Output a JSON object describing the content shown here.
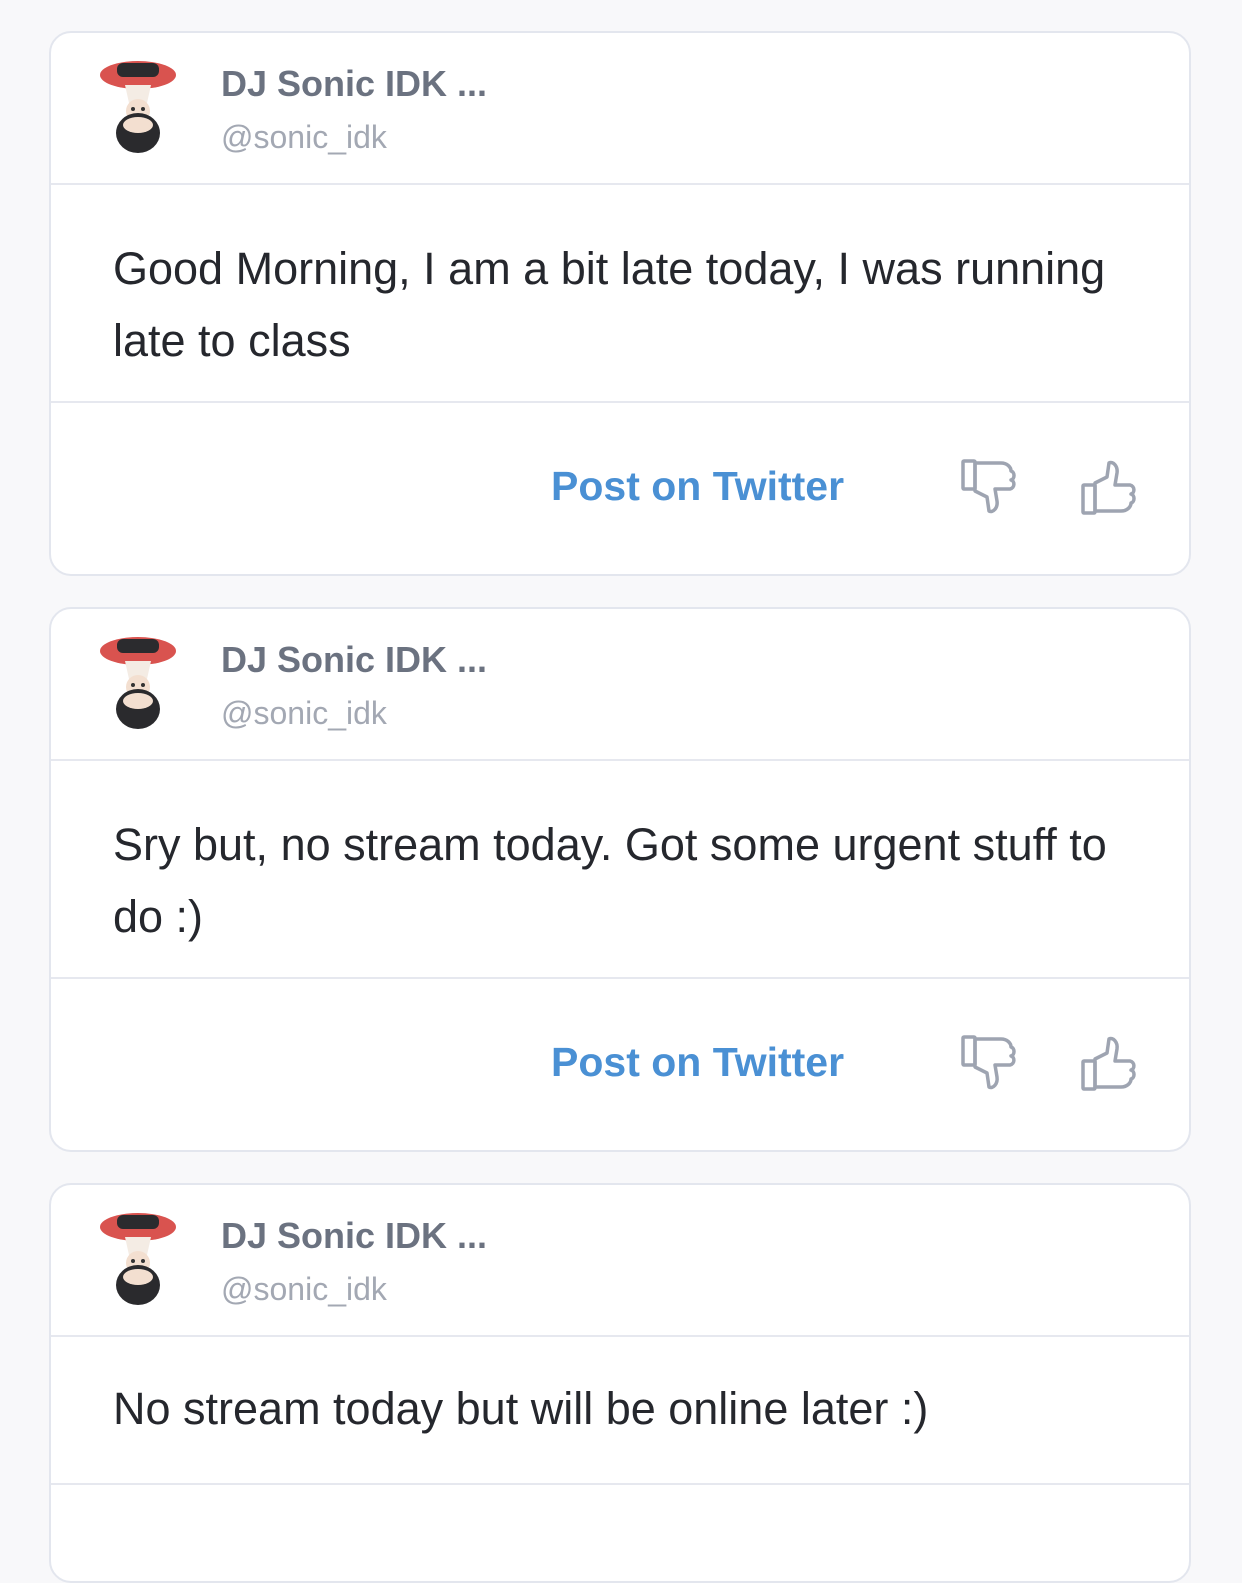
{
  "posts": [
    {
      "author": "DJ Sonic IDK ...",
      "handle": "@sonic_idk",
      "text": "Good Morning, I am a bit late today, I was running late to class",
      "action_label": "Post on Twitter"
    },
    {
      "author": "DJ Sonic IDK ...",
      "handle": "@sonic_idk",
      "text": "Sry but, no stream today. Got some urgent stuff to do :)",
      "action_label": "Post on Twitter"
    },
    {
      "author": "DJ Sonic IDK ...",
      "handle": "@sonic_idk",
      "text": "No stream today but will be online later :)"
    }
  ],
  "icons": {
    "avatar": "upside-down-character-avatar",
    "dislike": "thumbs-down-icon",
    "like": "thumbs-up-icon"
  },
  "colors": {
    "link": "#4a90d4",
    "author": "#6b7280",
    "handle": "#a3a8b3",
    "body_text": "#25272d",
    "border": "#e3e6ee",
    "icon": "#9ea4b1",
    "avatar_hat": "#d9534f"
  }
}
